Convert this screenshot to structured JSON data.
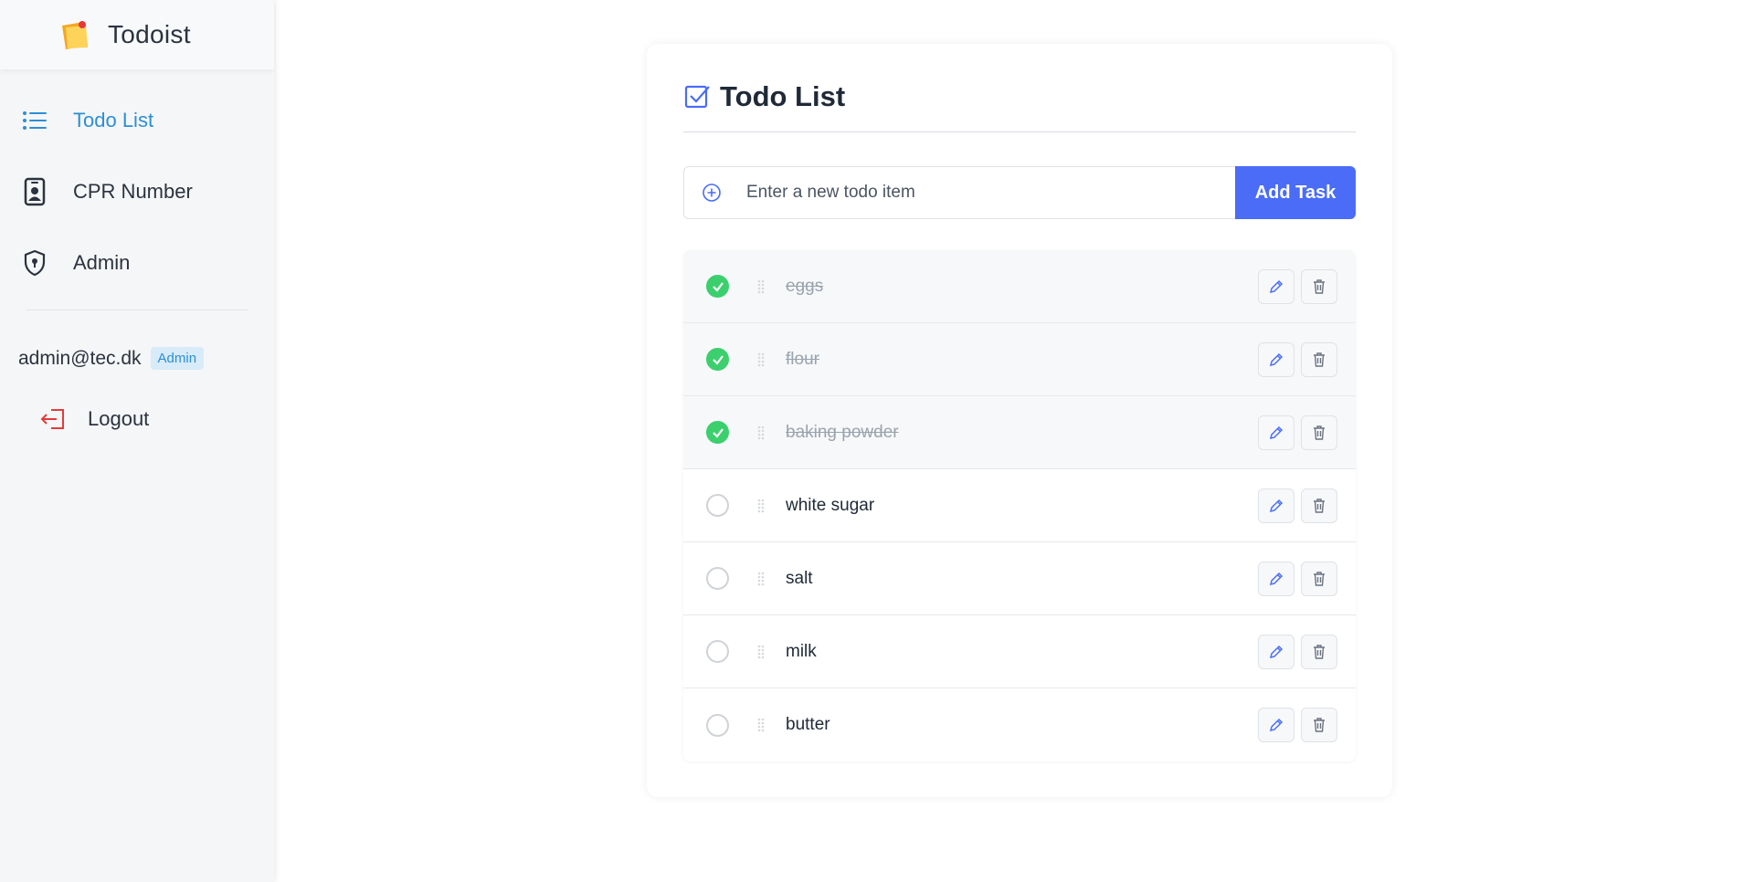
{
  "app": {
    "name": "Todoist"
  },
  "sidebar": {
    "items": [
      {
        "label": "Todo List",
        "icon": "list-icon",
        "active": true
      },
      {
        "label": "CPR Number",
        "icon": "id-badge-icon",
        "active": false
      },
      {
        "label": "Admin",
        "icon": "shield-lock-icon",
        "active": false
      }
    ],
    "user": {
      "email": "admin@tec.dk",
      "role": "Admin"
    },
    "logout_label": "Logout"
  },
  "main": {
    "title": "Todo List",
    "add": {
      "placeholder": "Enter a new todo item",
      "button_label": "Add Task"
    },
    "todos": [
      {
        "text": "eggs",
        "done": true
      },
      {
        "text": "flour",
        "done": true
      },
      {
        "text": "baking powder",
        "done": true
      },
      {
        "text": "white sugar",
        "done": false
      },
      {
        "text": "salt",
        "done": false
      },
      {
        "text": "milk",
        "done": false
      },
      {
        "text": "butter",
        "done": false
      }
    ]
  },
  "colors": {
    "accent": "#4a6cf7",
    "active_nav": "#2b8fd6",
    "done": "#3ccf6e",
    "logout": "#e23b3b"
  }
}
